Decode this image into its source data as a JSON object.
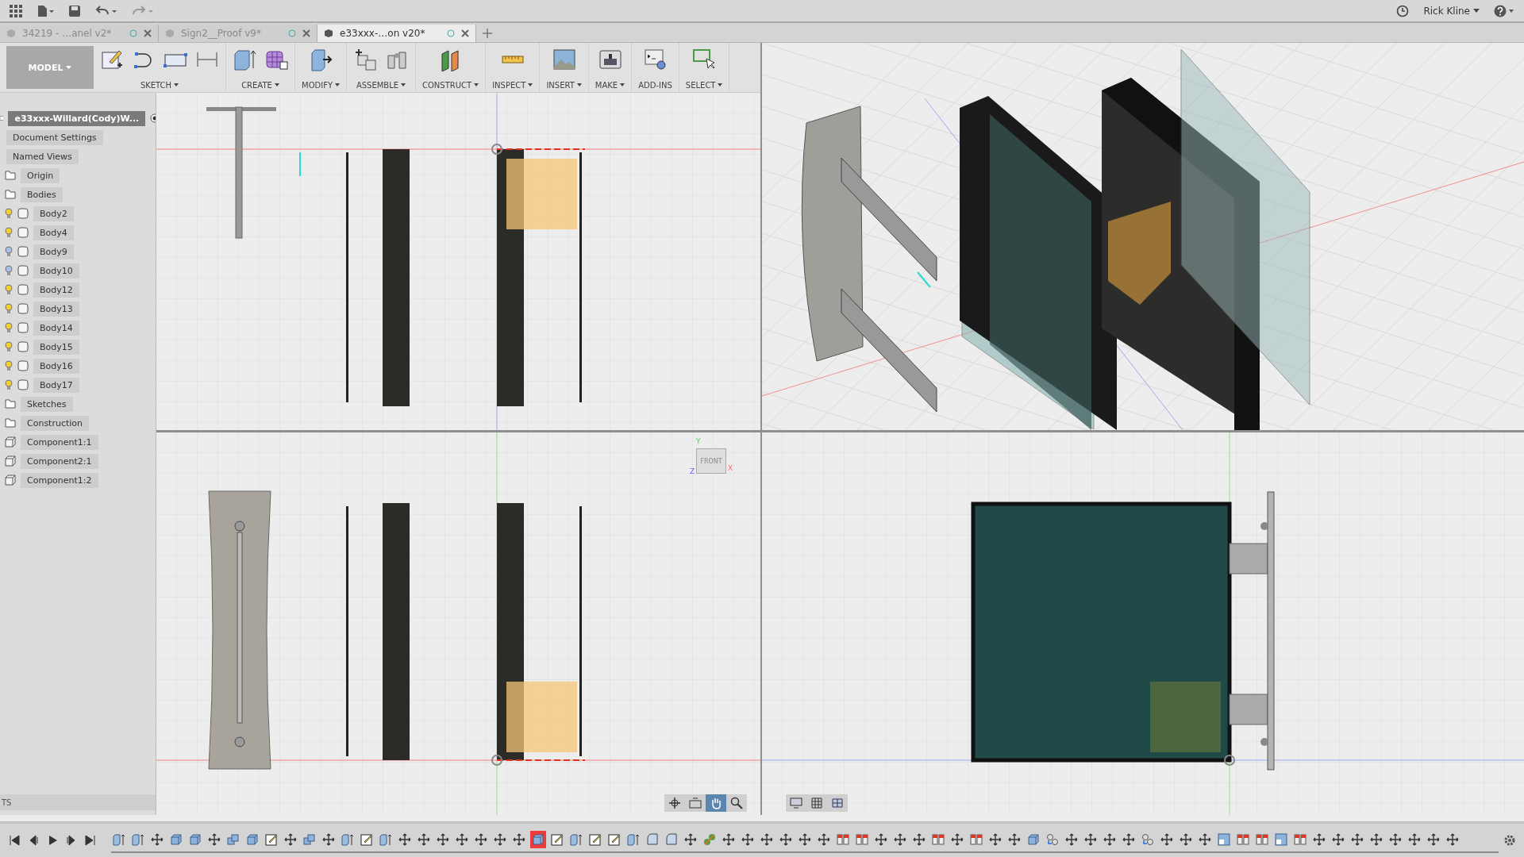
{
  "top_bar": {
    "user": "Rick Kline"
  },
  "tabs": [
    {
      "label": "34219 - …anel v2*",
      "selected": false
    },
    {
      "label": "Sign2__Proof v9*",
      "selected": false
    },
    {
      "label": "e33xxx-…on v20*",
      "selected": true
    }
  ],
  "workspace": {
    "label": "MODEL"
  },
  "tool_groups": [
    {
      "label": "SKETCH",
      "dropdown": true,
      "tools": [
        {
          "kind": "sketch"
        },
        {
          "kind": "arc"
        },
        {
          "kind": "rectangle"
        },
        {
          "kind": "dimension"
        }
      ]
    },
    {
      "label": "CREATE",
      "dropdown": true,
      "tools": [
        {
          "kind": "extrude"
        },
        {
          "kind": "form"
        }
      ]
    },
    {
      "label": "MODIFY",
      "dropdown": true,
      "tools": [
        {
          "kind": "presspull"
        }
      ]
    },
    {
      "label": "ASSEMBLE",
      "dropdown": true,
      "tools": [
        {
          "kind": "component"
        },
        {
          "kind": "joint"
        }
      ]
    },
    {
      "label": "CONSTRUCT",
      "dropdown": true,
      "tools": [
        {
          "kind": "plane"
        }
      ]
    },
    {
      "label": "INSPECT",
      "dropdown": true,
      "tools": [
        {
          "kind": "measure"
        }
      ]
    },
    {
      "label": "INSERT",
      "dropdown": true,
      "tools": [
        {
          "kind": "image"
        }
      ]
    },
    {
      "label": "MAKE",
      "dropdown": true,
      "tools": [
        {
          "kind": "printer"
        }
      ]
    },
    {
      "label": "ADD-INS",
      "dropdown": false,
      "tools": [
        {
          "kind": "script"
        }
      ]
    },
    {
      "label": "SELECT",
      "dropdown": true,
      "tools": [
        {
          "kind": "select"
        }
      ]
    }
  ],
  "browser": {
    "items": [
      {
        "kind": "root",
        "label": "e33xxx-Willard(Cody)W..."
      },
      {
        "kind": "setting",
        "label": "Document Settings"
      },
      {
        "kind": "setting",
        "label": "Named Views"
      },
      {
        "kind": "folder",
        "label": "Origin"
      },
      {
        "kind": "folder",
        "label": "Bodies"
      },
      {
        "kind": "body",
        "label": "Body2",
        "visible": true
      },
      {
        "kind": "body",
        "label": "Body4",
        "visible": true
      },
      {
        "kind": "body",
        "label": "Body9",
        "visible": false
      },
      {
        "kind": "body",
        "label": "Body10",
        "visible": false
      },
      {
        "kind": "body",
        "label": "Body12",
        "visible": true
      },
      {
        "kind": "body",
        "label": "Body13",
        "visible": true
      },
      {
        "kind": "body",
        "label": "Body14",
        "visible": true
      },
      {
        "kind": "body",
        "label": "Body15",
        "visible": true
      },
      {
        "kind": "body",
        "label": "Body16",
        "visible": true
      },
      {
        "kind": "body",
        "label": "Body17",
        "visible": true
      },
      {
        "kind": "folder",
        "label": "Sketches"
      },
      {
        "kind": "folder",
        "label": "Construction"
      },
      {
        "kind": "component",
        "label": "Component1:1"
      },
      {
        "kind": "component",
        "label": "Component2:1"
      },
      {
        "kind": "component",
        "label": "Component1:2"
      }
    ],
    "footer": "TS"
  },
  "view_cube": {
    "label": "FRONT",
    "x_axis": "X",
    "y_axis": "Y",
    "z_axis": "Z"
  },
  "timeline": [
    {
      "kind": "extrude",
      "error": false
    },
    {
      "kind": "extrude",
      "error": false
    },
    {
      "kind": "move",
      "error": false
    },
    {
      "kind": "box",
      "error": false
    },
    {
      "kind": "box",
      "error": false
    },
    {
      "kind": "move",
      "error": false
    },
    {
      "kind": "combine",
      "error": false
    },
    {
      "kind": "box",
      "error": false
    },
    {
      "kind": "sketch",
      "error": false
    },
    {
      "kind": "move",
      "error": false
    },
    {
      "kind": "combine",
      "error": false
    },
    {
      "kind": "move",
      "error": false
    },
    {
      "kind": "extrude",
      "error": false
    },
    {
      "kind": "sketch",
      "error": false
    },
    {
      "kind": "extrude",
      "error": false
    },
    {
      "kind": "move",
      "error": false
    },
    {
      "kind": "move",
      "error": false
    },
    {
      "kind": "move",
      "error": false
    },
    {
      "kind": "move",
      "error": false
    },
    {
      "kind": "move",
      "error": false
    },
    {
      "kind": "move",
      "error": false
    },
    {
      "kind": "move",
      "error": false
    },
    {
      "kind": "box",
      "error": true
    },
    {
      "kind": "sketch",
      "error": false
    },
    {
      "kind": "extrude",
      "error": false
    },
    {
      "kind": "sketch",
      "error": false
    },
    {
      "kind": "sketch",
      "error": false
    },
    {
      "kind": "extrude",
      "error": false
    },
    {
      "kind": "fillet",
      "error": false
    },
    {
      "kind": "fillet",
      "error": false
    },
    {
      "kind": "move",
      "error": false
    },
    {
      "kind": "joint",
      "error": false
    },
    {
      "kind": "move",
      "error": false
    },
    {
      "kind": "move",
      "error": false
    },
    {
      "kind": "move",
      "error": false
    },
    {
      "kind": "move",
      "error": false
    },
    {
      "kind": "move",
      "error": false
    },
    {
      "kind": "move",
      "error": false
    },
    {
      "kind": "align",
      "error": false
    },
    {
      "kind": "align",
      "error": false
    },
    {
      "kind": "move",
      "error": false
    },
    {
      "kind": "move",
      "error": false
    },
    {
      "kind": "move",
      "error": false
    },
    {
      "kind": "align",
      "error": false
    },
    {
      "kind": "move",
      "error": false
    },
    {
      "kind": "align",
      "error": false
    },
    {
      "kind": "move",
      "error": false
    },
    {
      "kind": "move",
      "error": false
    },
    {
      "kind": "box",
      "error": false
    },
    {
      "kind": "rigid",
      "error": false
    },
    {
      "kind": "move",
      "error": false
    },
    {
      "kind": "move",
      "error": false
    },
    {
      "kind": "move",
      "error": false
    },
    {
      "kind": "move",
      "error": false
    },
    {
      "kind": "rigid",
      "error": false
    },
    {
      "kind": "move",
      "error": false
    },
    {
      "kind": "move",
      "error": false
    },
    {
      "kind": "move",
      "error": false
    },
    {
      "kind": "section",
      "error": false
    },
    {
      "kind": "align",
      "error": false
    },
    {
      "kind": "align",
      "error": false
    },
    {
      "kind": "section",
      "error": false
    },
    {
      "kind": "align",
      "error": false
    },
    {
      "kind": "move",
      "error": false
    },
    {
      "kind": "move",
      "error": false
    },
    {
      "kind": "move",
      "error": false
    },
    {
      "kind": "move",
      "error": false
    },
    {
      "kind": "move",
      "error": false
    },
    {
      "kind": "move",
      "error": false
    },
    {
      "kind": "move",
      "error": false
    },
    {
      "kind": "move",
      "error": false
    }
  ]
}
